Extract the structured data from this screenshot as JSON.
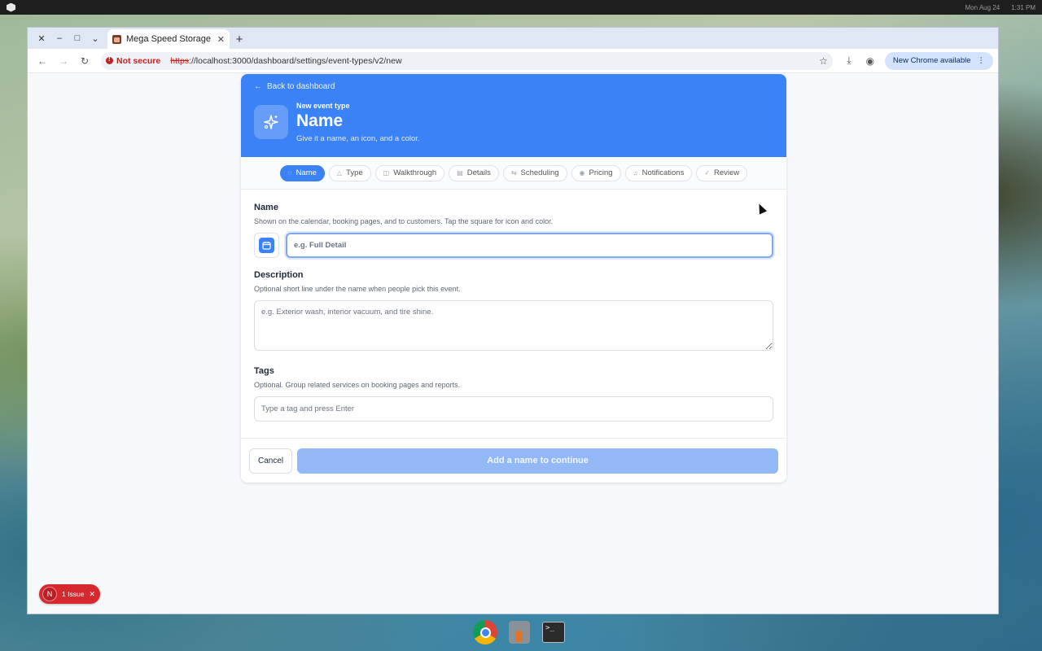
{
  "os": {
    "clock_date": "Mon Aug 24",
    "clock_time": "1:31 PM"
  },
  "browser": {
    "tab_title": "Mega Speed Storage",
    "not_secure_label": "Not secure",
    "url_scheme": "https",
    "url_rest": "://localhost:3000/dashboard/settings/event-types/v2/new",
    "update_label": "New Chrome available"
  },
  "header": {
    "back_label": "Back to dashboard",
    "eyebrow": "New event type",
    "title": "Name",
    "subtitle": "Give it a name, an icon, and a color."
  },
  "steps": [
    {
      "label": "Name",
      "active": true
    },
    {
      "label": "Type"
    },
    {
      "label": "Walkthrough"
    },
    {
      "label": "Details"
    },
    {
      "label": "Scheduling"
    },
    {
      "label": "Pricing"
    },
    {
      "label": "Notifications"
    },
    {
      "label": "Review"
    }
  ],
  "form": {
    "name_label": "Name",
    "name_help": "Shown on the calendar, booking pages, and to customers. Tap the square for icon and color.",
    "name_placeholder": "e.g. Full Detail",
    "description_label": "Description",
    "description_help": "Optional short line under the name when people pick this event.",
    "description_placeholder": "e.g. Exterior wash, interior vacuum, and tire shine.",
    "tags_label": "Tags",
    "tags_help": "Optional. Group related services on booking pages and reports.",
    "tags_placeholder": "Type a tag and press Enter"
  },
  "footer": {
    "cancel_label": "Cancel",
    "continue_label": "Add a name to continue"
  },
  "issue_badge": {
    "initial": "N",
    "label": "1 Issue"
  },
  "colors": {
    "accent": "#3b82f6",
    "accent_disabled": "#93b8f6",
    "error": "#d5292f"
  }
}
